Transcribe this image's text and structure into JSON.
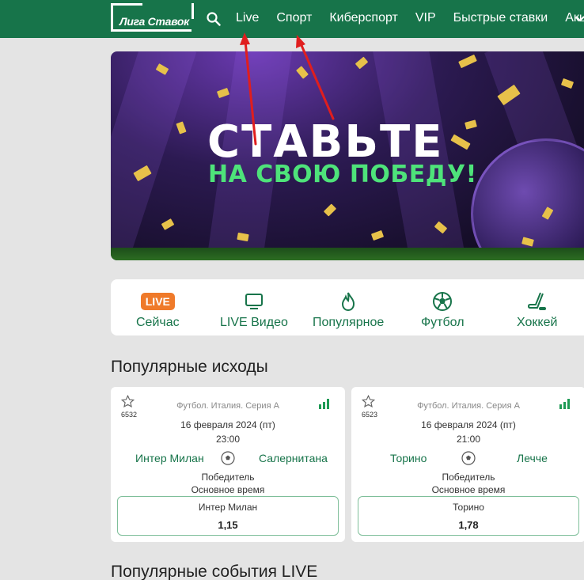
{
  "header": {
    "logo_text": "Лига Ставок",
    "nav": [
      "Live",
      "Спорт",
      "Киберспорт",
      "VIP",
      "Быстрые ставки",
      "Акции"
    ]
  },
  "banner": {
    "title": "СТАВЬТЕ",
    "subtitle": "НА СВОЮ ПОБЕДУ!"
  },
  "quick_links": {
    "items": [
      {
        "badge": "LIVE",
        "label": "Сейчас",
        "icon": "live-badge-icon"
      },
      {
        "label": "LIVE Видео",
        "icon": "tv-icon"
      },
      {
        "label": "Популярное",
        "icon": "fire-icon"
      },
      {
        "label": "Футбол",
        "icon": "soccer-ball-icon"
      },
      {
        "label": "Хоккей",
        "icon": "hockey-stick-icon"
      }
    ]
  },
  "popular_outcomes": {
    "title": "Популярные исходы",
    "cards": [
      {
        "fav_count": "6532",
        "league": "Футбол. Италия. Серия А",
        "date": "16 февраля 2024 (пт)",
        "time": "23:00",
        "team_home": "Интер Милан",
        "team_away": "Салернитана",
        "market": "Победитель",
        "period": "Основное время",
        "outcome": "Интер Милан",
        "odd": "1,15"
      },
      {
        "fav_count": "6523",
        "league": "Футбол. Италия. Серия А",
        "date": "16 февраля 2024 (пт)",
        "time": "21:00",
        "team_home": "Торино",
        "team_away": "Лечче",
        "market": "Победитель",
        "period": "Основное время",
        "outcome": "Торино",
        "odd": "1,78"
      }
    ]
  },
  "live_section": {
    "title": "Популярные события LIVE"
  },
  "colors": {
    "brand_green": "#17744a",
    "live_orange": "#ef7a2a",
    "annotation_red": "#e01e1e"
  }
}
